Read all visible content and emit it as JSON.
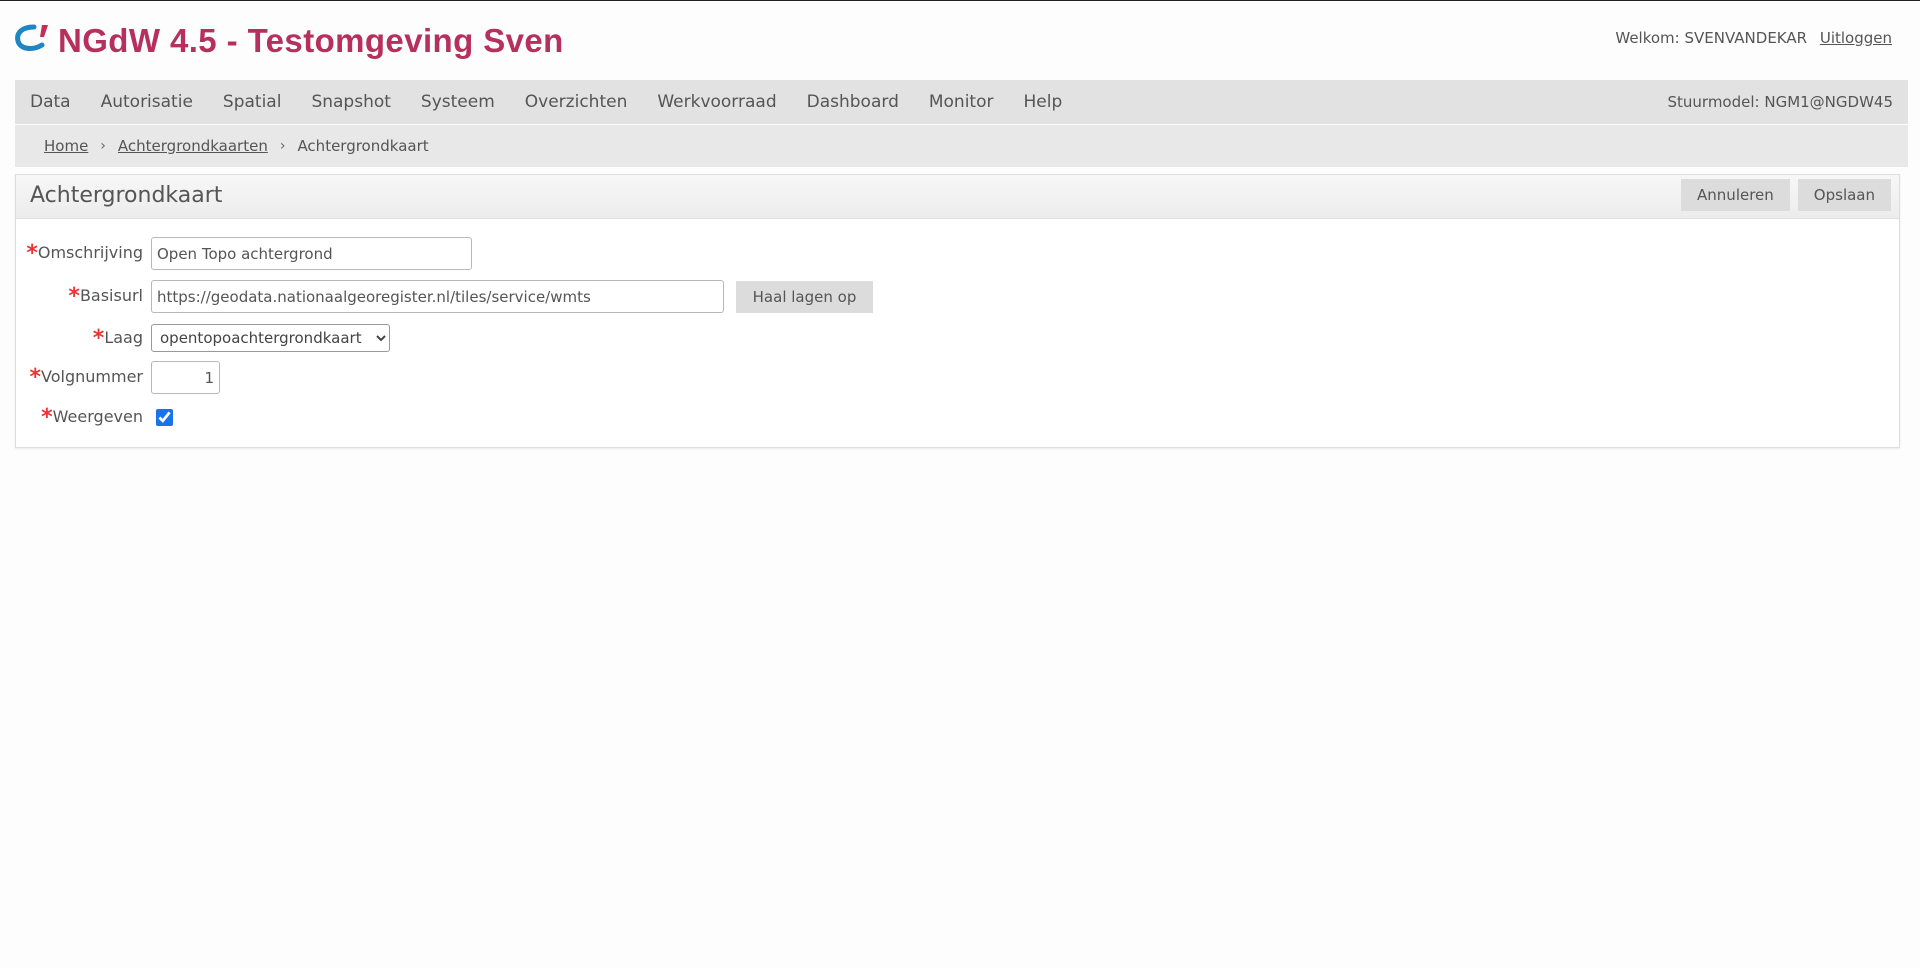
{
  "app": {
    "title": "NGdW 4.5 - Testomgeving Sven"
  },
  "user": {
    "welcome_label": "Welkom:",
    "username": "SVENVANDEKAR",
    "logout_label": "Uitloggen"
  },
  "nav": {
    "items": [
      "Data",
      "Autorisatie",
      "Spatial",
      "Snapshot",
      "Systeem",
      "Overzichten",
      "Werkvoorraad",
      "Dashboard",
      "Monitor",
      "Help"
    ],
    "stuurmodel": "Stuurmodel: NGM1@NGDW45"
  },
  "breadcrumb": {
    "home": "Home",
    "parent": "Achtergrondkaarten",
    "current": "Achtergrondkaart"
  },
  "panel": {
    "title": "Achtergrondkaart",
    "cancel_label": "Annuleren",
    "save_label": "Opslaan"
  },
  "form": {
    "required_marker": "*",
    "omschrijving": {
      "label": "Omschrijving",
      "value": "Open Topo achtergrond"
    },
    "basisurl": {
      "label": "Basisurl",
      "value": "https://geodata.nationaalgeoregister.nl/tiles/service/wmts",
      "button_label": "Haal lagen op"
    },
    "laag": {
      "label": "Laag",
      "selected": "opentopoachtergrondkaart"
    },
    "volgnummer": {
      "label": "Volgnummer",
      "value": "1"
    },
    "weergeven": {
      "label": "Weergeven",
      "checked": true
    }
  },
  "colors": {
    "brand": "#b5305c",
    "logo": "#1f86c6",
    "logo_accent": "#c0305a",
    "required": "#e33333"
  },
  "icons": {
    "logo": "ngdw-logo-icon",
    "breadcrumb_separator": "chevron-right-icon",
    "select_arrow": "chevron-down-icon"
  }
}
